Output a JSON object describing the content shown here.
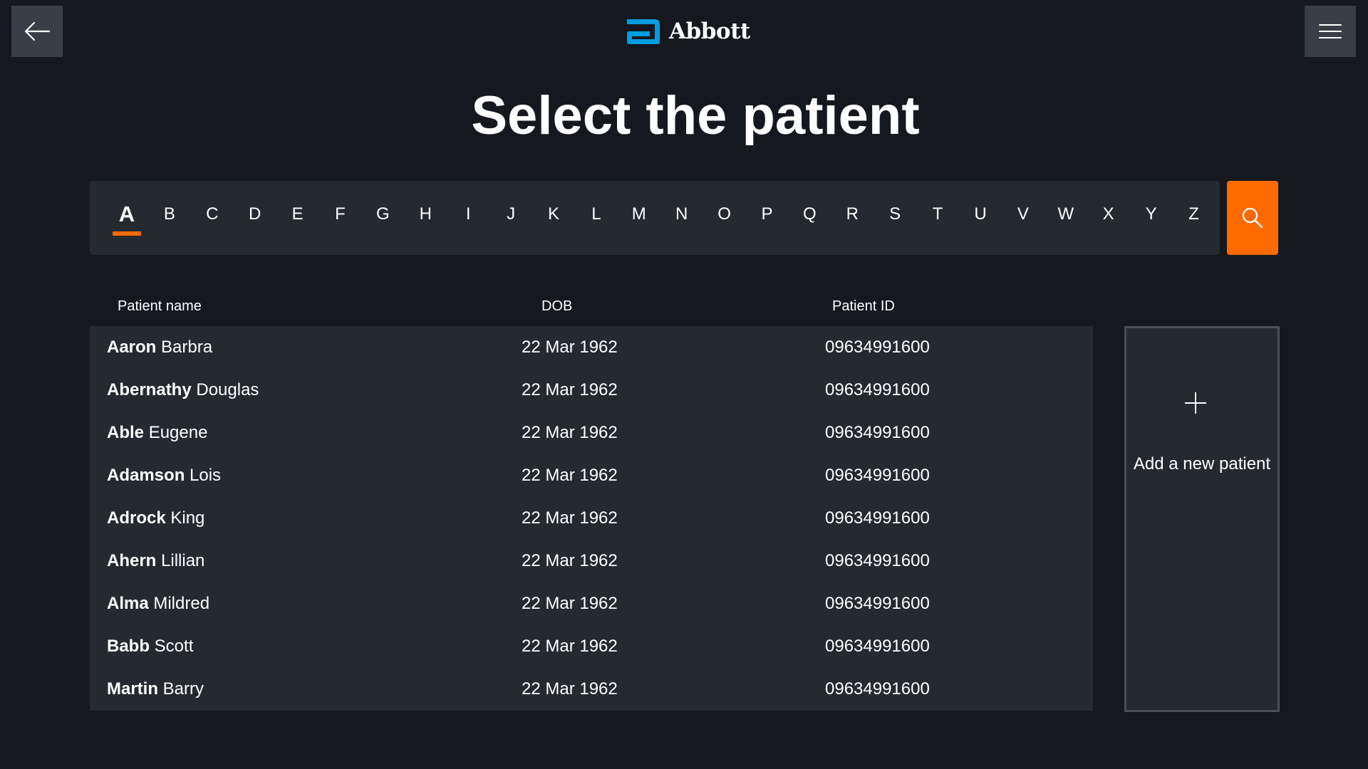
{
  "header": {
    "brand": "Abbott",
    "back_icon": "arrow-left-icon",
    "menu_icon": "hamburger-menu-icon"
  },
  "title": "Select the patient",
  "alphabet": {
    "letters": [
      "A",
      "B",
      "C",
      "D",
      "E",
      "F",
      "G",
      "H",
      "I",
      "J",
      "K",
      "L",
      "M",
      "N",
      "O",
      "P",
      "Q",
      "R",
      "S",
      "T",
      "U",
      "V",
      "W",
      "X",
      "Y",
      "Z"
    ],
    "active": "A",
    "search_icon": "search-icon"
  },
  "table": {
    "columns": [
      "Patient name",
      "DOB",
      "Patient ID"
    ],
    "rows": [
      {
        "last": "Aaron",
        "first": "Barbra",
        "dob": "22 Mar 1962",
        "id": "09634991600"
      },
      {
        "last": "Abernathy",
        "first": "Douglas",
        "dob": "22 Mar 1962",
        "id": "09634991600"
      },
      {
        "last": "Able",
        "first": "Eugene",
        "dob": "22 Mar 1962",
        "id": "09634991600"
      },
      {
        "last": "Adamson",
        "first": "Lois",
        "dob": "22 Mar 1962",
        "id": "09634991600"
      },
      {
        "last": "Adrock",
        "first": "King",
        "dob": "22 Mar 1962",
        "id": "09634991600"
      },
      {
        "last": "Ahern",
        "first": "Lillian",
        "dob": "22 Mar 1962",
        "id": "09634991600"
      },
      {
        "last": "Alma",
        "first": "Mildred",
        "dob": "22 Mar 1962",
        "id": "09634991600"
      },
      {
        "last": "Babb",
        "first": "Scott",
        "dob": "22 Mar 1962",
        "id": "09634991600"
      },
      {
        "last": "Martin",
        "first": "Barry",
        "dob": "22 Mar 1962",
        "id": "09634991600"
      }
    ]
  },
  "add_patient": {
    "label": "Add a new patient",
    "icon": "plus-icon"
  },
  "colors": {
    "background": "#15191f",
    "panel": "#252a31",
    "accent": "#ff6a00",
    "brand_blue": "#009cde"
  }
}
